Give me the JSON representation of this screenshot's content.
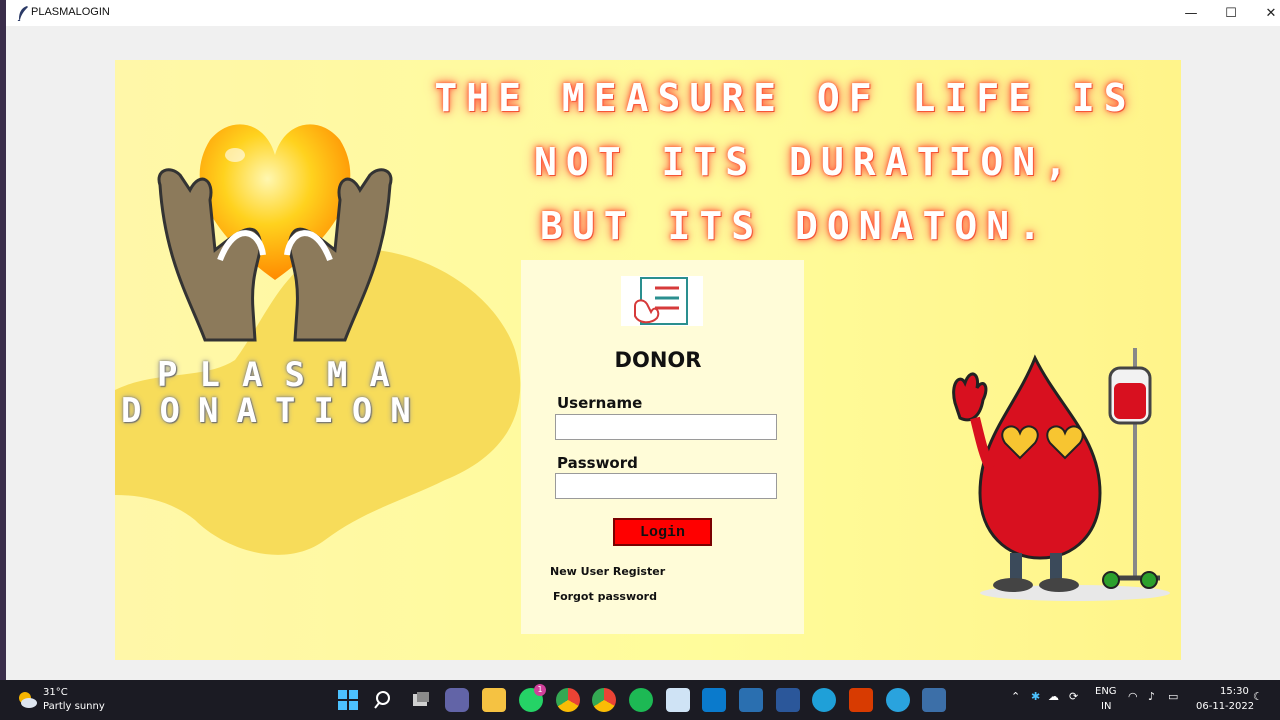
{
  "window": {
    "title": "PLASMALOGIN",
    "minimize": "—",
    "maximize": "☐",
    "close": "✕"
  },
  "banner": {
    "quote_line1": "THE MEASURE OF LIFE IS",
    "quote_line2": "NOT ITS DURATION,",
    "quote_line3": "BUT ITS DONATON.",
    "brand_line1": "PLASMA",
    "brand_line2": "DONATION"
  },
  "login": {
    "title": "DONOR",
    "username_label": "Username",
    "username_value": "",
    "password_label": "Password",
    "password_value": "",
    "login_button": "Login",
    "register_link": "New User Register",
    "forgot_link": "Forgot password"
  },
  "taskbar": {
    "temperature": "31°C",
    "weather": "Partly sunny",
    "lang_line1": "ENG",
    "lang_line2": "IN",
    "time": "15:30",
    "date": "06-11-2022",
    "whatsapp_badge": "1"
  },
  "colors": {
    "background": "#fff9a0",
    "panel": "#fffcd8",
    "login_button": "#ff0000",
    "quote_glow": "#ff5a3c"
  }
}
